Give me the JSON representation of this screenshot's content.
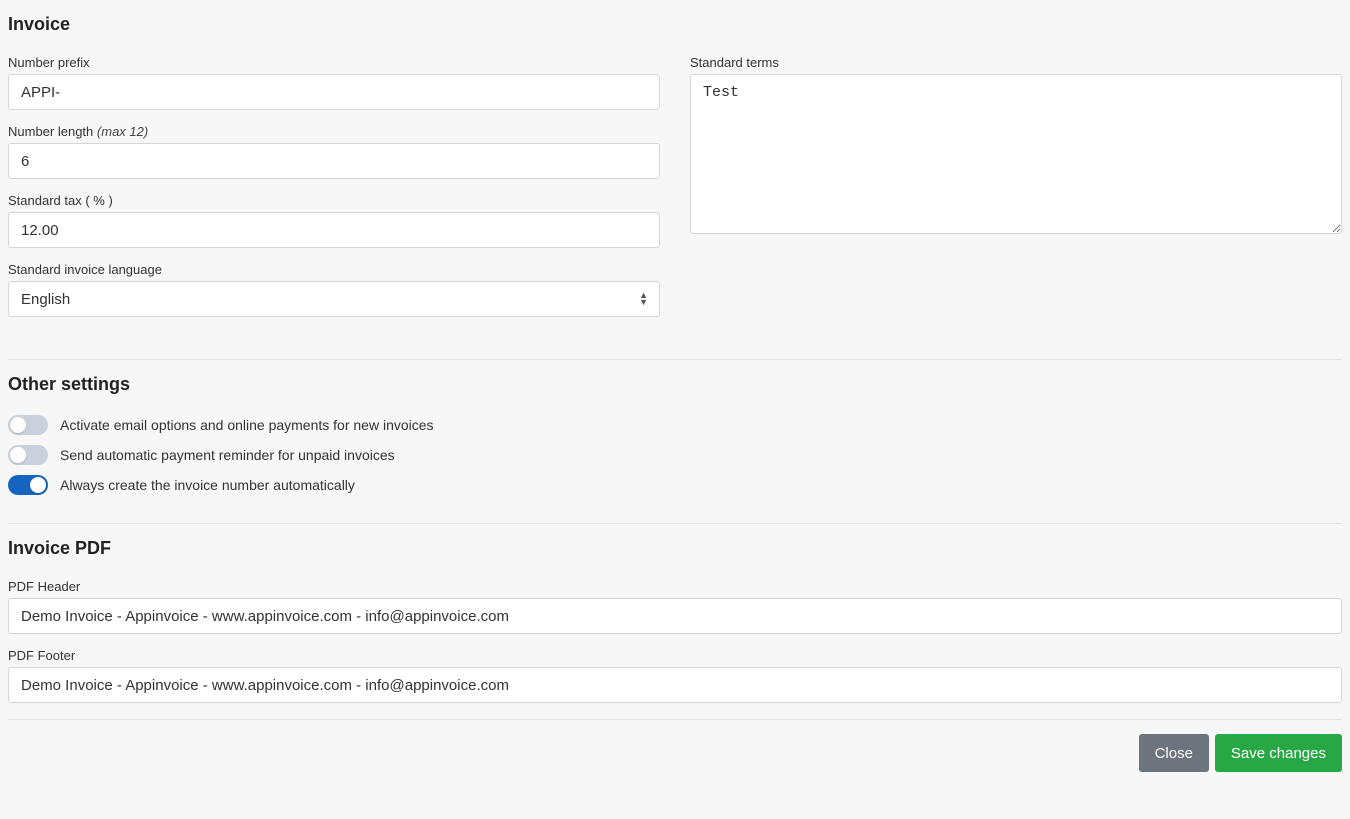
{
  "invoice": {
    "section_title": "Invoice",
    "number_prefix": {
      "label": "Number prefix",
      "value": "APPI-"
    },
    "number_length": {
      "label": "Number length",
      "hint": "(max 12)",
      "value": "6"
    },
    "standard_tax": {
      "label": "Standard tax ( % )",
      "value": "12.00"
    },
    "standard_language": {
      "label": "Standard invoice language",
      "value": "English"
    },
    "standard_terms": {
      "label": "Standard terms",
      "value": "Test"
    }
  },
  "other": {
    "section_title": "Other settings",
    "toggles": [
      {
        "label": "Activate email options and online payments for new invoices",
        "on": false
      },
      {
        "label": "Send automatic payment reminder for unpaid invoices",
        "on": false
      },
      {
        "label": "Always create the invoice number automatically",
        "on": true
      }
    ]
  },
  "pdf": {
    "section_title": "Invoice PDF",
    "header": {
      "label": "PDF Header",
      "value": "Demo Invoice - Appinvoice - www.appinvoice.com - info@appinvoice.com"
    },
    "footer": {
      "label": "PDF Footer",
      "value": "Demo Invoice - Appinvoice - www.appinvoice.com - info@appinvoice.com"
    }
  },
  "buttons": {
    "close": "Close",
    "save": "Save changes"
  }
}
